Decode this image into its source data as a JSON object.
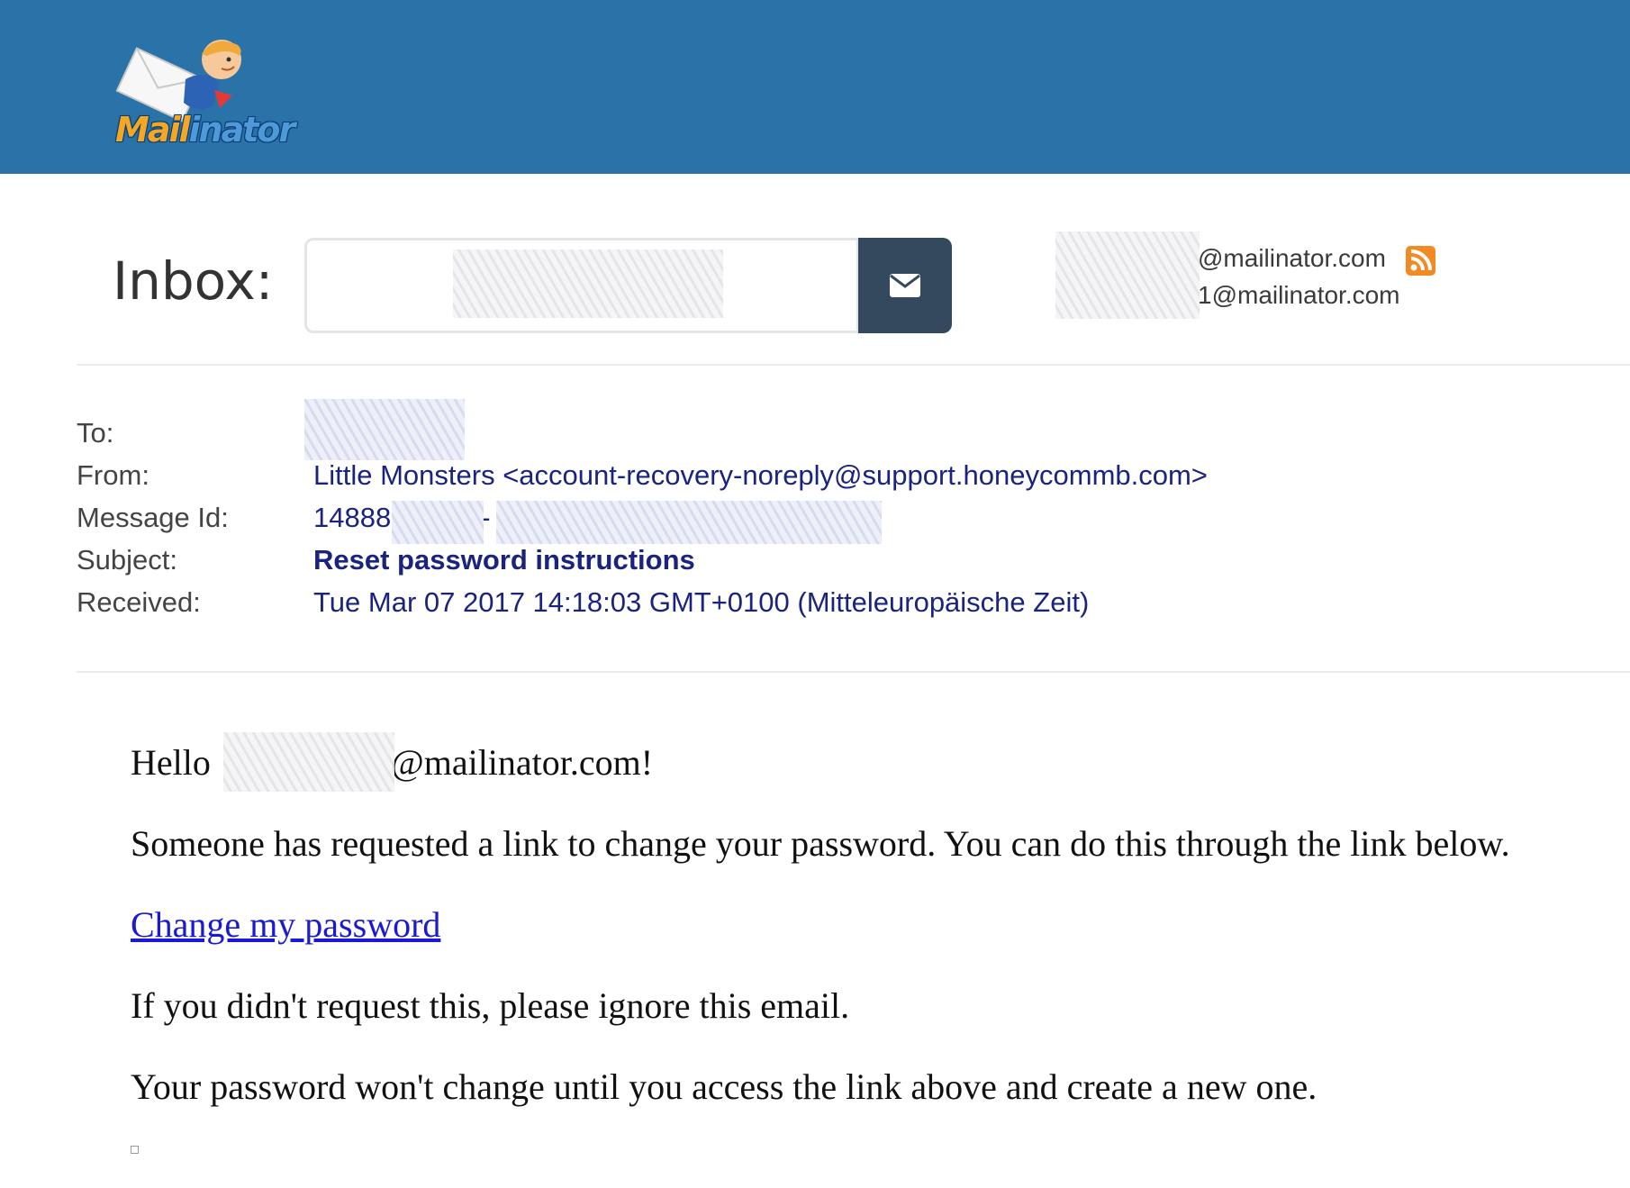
{
  "header": {
    "logo_text_mail": "Mail",
    "logo_text_inator": "inator",
    "background_color": "#2a73a8"
  },
  "inbox": {
    "label": "Inbox:",
    "input_value": "",
    "go_icon": "envelope-icon",
    "aliases": [
      "@mailinator.com",
      "1@mailinator.com"
    ],
    "rss_icon": "rss-icon"
  },
  "message": {
    "fields": {
      "to_label": "To:",
      "to_value": "",
      "from_label": "From:",
      "from_value": "Little Monsters <account-recovery-noreply@support.honeycommb.com>",
      "message_id_label": "Message Id:",
      "message_id_prefix": "14888",
      "message_id_sep": "-",
      "subject_label": "Subject:",
      "subject_value": "Reset password instructions",
      "received_label": "Received:",
      "received_value": "Tue Mar 07 2017 14:18:03 GMT+0100 (Mitteleuropäische Zeit)"
    },
    "body": {
      "greeting_prefix": "Hello",
      "greeting_suffix": "@mailinator.com!",
      "line1": "Someone has requested a link to change your password. You can do this through the link below.",
      "link_text": "Change my password",
      "line2": "If you didn't request this, please ignore this email.",
      "line3": "Your password won't change until you access the link above and create a new one."
    }
  }
}
